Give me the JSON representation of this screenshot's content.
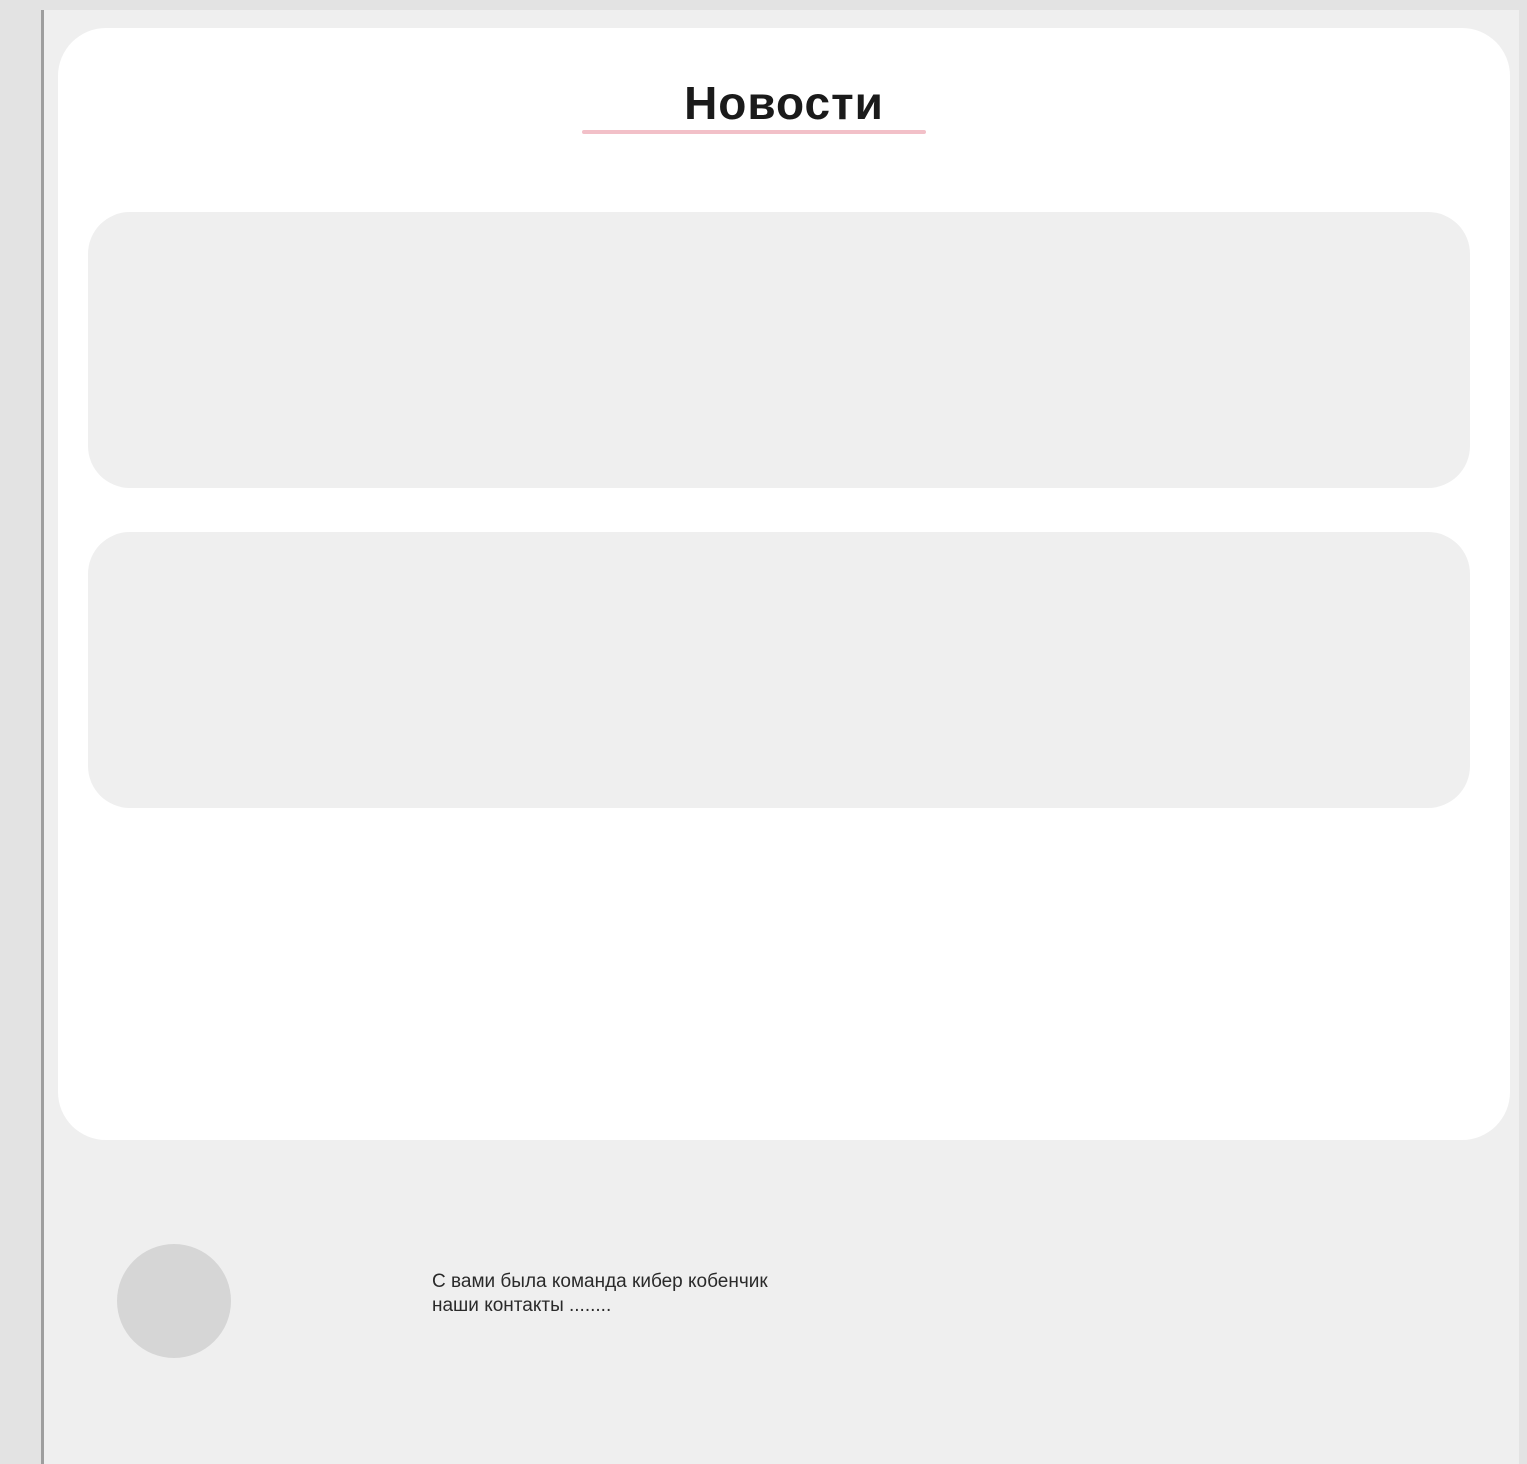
{
  "news": {
    "title": "Новости",
    "cards": [
      {
        "id": "news-card-1"
      },
      {
        "id": "news-card-2"
      }
    ]
  },
  "footer": {
    "line1": "С вами была команда кибер кобенчик",
    "line2": "наши контакты ........"
  },
  "colors": {
    "background": "#e3e3e3",
    "page": "#efefef",
    "panel": "#ffffff",
    "card": "#efefef",
    "underline": "#f2c0c8",
    "avatar": "#d6d6d6"
  }
}
